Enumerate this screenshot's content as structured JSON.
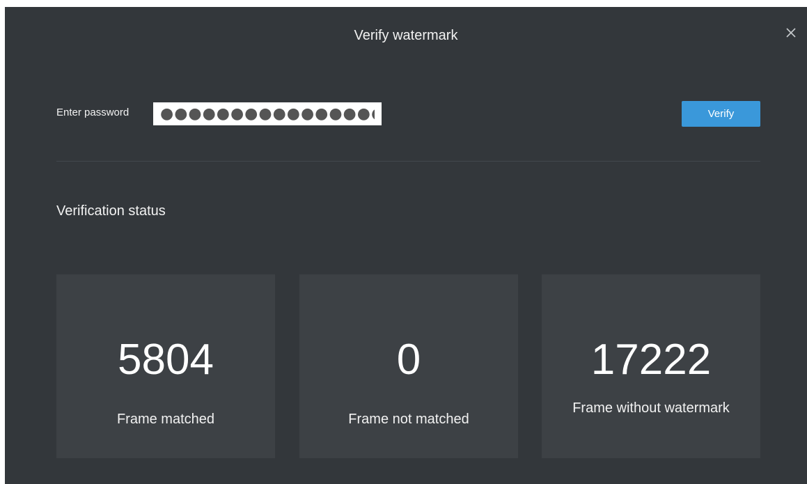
{
  "dialog": {
    "title": "Verify watermark",
    "close_icon": "close-icon"
  },
  "password": {
    "label": "Enter password",
    "value": "●●●●●●●●●●●●●●●●●"
  },
  "verify_button": {
    "label": "Verify",
    "color": "#3a98da"
  },
  "status": {
    "heading": "Verification status",
    "cards": [
      {
        "count": "5804",
        "label": "Frame matched"
      },
      {
        "count": "0",
        "label": "Frame not matched"
      },
      {
        "count": "17222",
        "label": "Frame without watermark"
      }
    ]
  },
  "colors": {
    "background": "#33373b",
    "card": "#3d4145",
    "text": "#ffffff"
  }
}
